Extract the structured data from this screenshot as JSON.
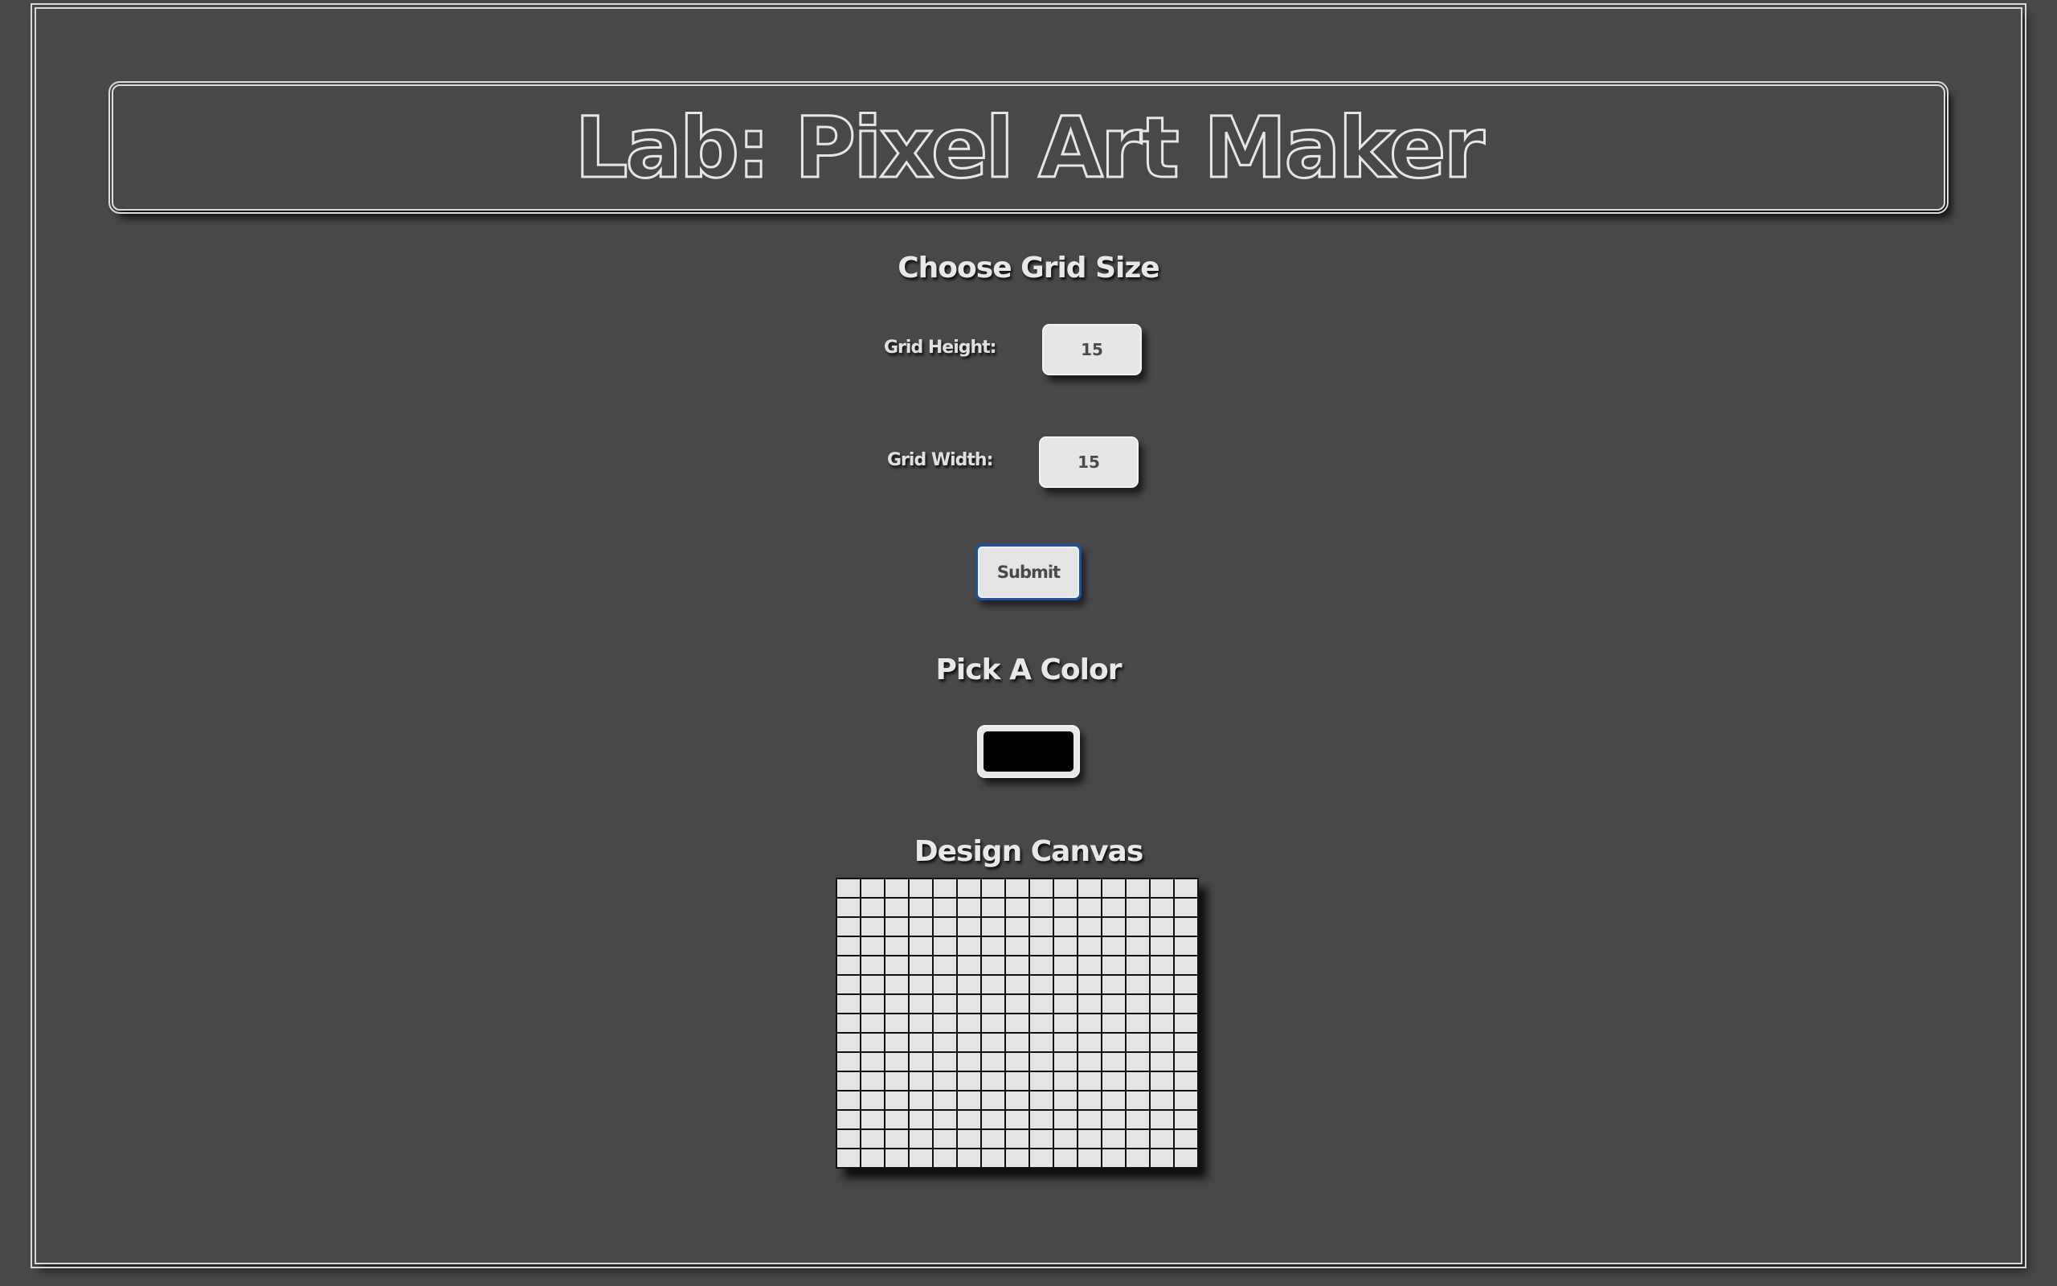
{
  "header": {
    "title": "Lab: Pixel Art Maker"
  },
  "grid_size": {
    "heading": "Choose Grid Size",
    "height_label": "Grid Height:",
    "height_value": "15",
    "width_label": "Grid Width:",
    "width_value": "15",
    "submit_label": "Submit"
  },
  "color": {
    "heading": "Pick A Color",
    "selected_color": "#000000"
  },
  "canvas": {
    "heading": "Design Canvas",
    "rows": 15,
    "cols": 15,
    "cell_color": "#e4e4e4",
    "border_color": "#111111"
  },
  "theme": {
    "background": "#484848",
    "text": "#e8e8e8",
    "submit_focus": "#1f4fa0"
  }
}
